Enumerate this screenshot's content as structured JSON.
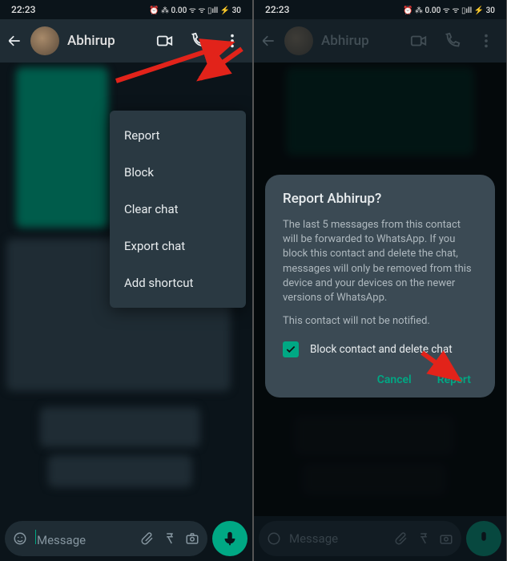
{
  "status": {
    "time": "22:23",
    "indicators": "⏰ ⁂ 0.00 ᯤ ᯤ ▯ıll ⚡ 30"
  },
  "header": {
    "contact_name": "Abhirup"
  },
  "menu": {
    "items": [
      "Report",
      "Block",
      "Clear chat",
      "Export chat",
      "Add shortcut"
    ]
  },
  "input": {
    "placeholder": "Message"
  },
  "dialog": {
    "title": "Report Abhirup?",
    "body": "The last 5 messages from this contact will be forwarded to WhatsApp. If you block this contact and delete the chat, messages will only be removed from this device and your devices on the newer versions of WhatsApp.",
    "note": "This contact will not be notified.",
    "checkbox_label": "Block contact and delete chat",
    "cancel": "Cancel",
    "confirm": "Report"
  }
}
